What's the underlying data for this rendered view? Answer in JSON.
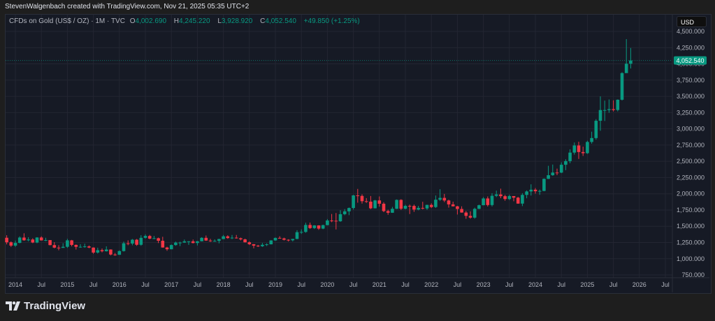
{
  "credit": "StevenWalgenbach created with TradingView.com, Nov 21, 2025 05:35 UTC+2",
  "legend": {
    "symbol": "CFDs on Gold (US$ / OZ) · 1M · TVC",
    "o_label": "O",
    "o_value": "4,002.690",
    "h_label": "H",
    "h_value": "4,245.220",
    "l_label": "L",
    "l_value": "3,928.920",
    "c_label": "C",
    "c_value": "4,052.540",
    "change": "+49.850 (+1.25%)"
  },
  "currency_button": "USD",
  "last_price_label": "4,052.540",
  "footer": {
    "brand": "TradingView"
  },
  "colors": {
    "up": "#089981",
    "down": "#f23645",
    "background": "#161a25",
    "grid": "#232632"
  },
  "chart_data": {
    "type": "candlestick",
    "interval": "1M",
    "start_month": "2013-11",
    "last_price": 4052.54,
    "ylim": [
      750,
      4500
    ],
    "y_ticks": [
      "4,500.000",
      "4,250.000",
      "4,000.000",
      "3,750.000",
      "3,500.000",
      "3,250.000",
      "3,000.000",
      "2,750.000",
      "2,500.000",
      "2,250.000",
      "2,000.000",
      "1,750.000",
      "1,500.000",
      "1,250.000",
      "1,000.000",
      "750.000"
    ],
    "x_ticks": [
      "2014",
      "Jul",
      "2015",
      "Jul",
      "2016",
      "Jul",
      "2017",
      "Jul",
      "2018",
      "Jul",
      "2019",
      "Jul",
      "2020",
      "Jul",
      "2021",
      "Jul",
      "2022",
      "Jul",
      "2023",
      "Jul",
      "2024",
      "Jul",
      "2025",
      "Jul",
      "2026",
      "Jul"
    ],
    "grid": true,
    "ohlc": [
      [
        1323,
        1362,
        1221,
        1253
      ],
      [
        1253,
        1267,
        1181,
        1202
      ],
      [
        1202,
        1280,
        1182,
        1244
      ],
      [
        1244,
        1345,
        1238,
        1326
      ],
      [
        1326,
        1392,
        1277,
        1284
      ],
      [
        1284,
        1331,
        1268,
        1296
      ],
      [
        1296,
        1315,
        1240,
        1250
      ],
      [
        1250,
        1332,
        1240,
        1327
      ],
      [
        1327,
        1345,
        1280,
        1282
      ],
      [
        1282,
        1323,
        1271,
        1287
      ],
      [
        1287,
        1288,
        1206,
        1210
      ],
      [
        1210,
        1255,
        1161,
        1171
      ],
      [
        1171,
        1208,
        1131,
        1167
      ],
      [
        1167,
        1239,
        1170,
        1184
      ],
      [
        1184,
        1307,
        1167,
        1283
      ],
      [
        1283,
        1290,
        1191,
        1213
      ],
      [
        1213,
        1220,
        1142,
        1183
      ],
      [
        1183,
        1224,
        1170,
        1184
      ],
      [
        1184,
        1232,
        1170,
        1190
      ],
      [
        1190,
        1205,
        1162,
        1172
      ],
      [
        1172,
        1175,
        1077,
        1095
      ],
      [
        1095,
        1170,
        1080,
        1132
      ],
      [
        1132,
        1157,
        1098,
        1115
      ],
      [
        1115,
        1191,
        1111,
        1142
      ],
      [
        1142,
        1145,
        1052,
        1065
      ],
      [
        1065,
        1088,
        1046,
        1061
      ],
      [
        1061,
        1129,
        1060,
        1118
      ],
      [
        1118,
        1263,
        1110,
        1238
      ],
      [
        1238,
        1283,
        1208,
        1234
      ],
      [
        1234,
        1304,
        1207,
        1293
      ],
      [
        1293,
        1304,
        1199,
        1215
      ],
      [
        1215,
        1362,
        1200,
        1322
      ],
      [
        1322,
        1375,
        1310,
        1351
      ],
      [
        1351,
        1367,
        1301,
        1309
      ],
      [
        1309,
        1352,
        1302,
        1316
      ],
      [
        1316,
        1326,
        1241,
        1277
      ],
      [
        1277,
        1338,
        1171,
        1173
      ],
      [
        1173,
        1184,
        1122,
        1146
      ],
      [
        1146,
        1220,
        1146,
        1211
      ],
      [
        1211,
        1264,
        1200,
        1249
      ],
      [
        1249,
        1262,
        1195,
        1249
      ],
      [
        1249,
        1296,
        1244,
        1268
      ],
      [
        1268,
        1272,
        1214,
        1268
      ],
      [
        1268,
        1296,
        1236,
        1242
      ],
      [
        1242,
        1273,
        1204,
        1269
      ],
      [
        1269,
        1331,
        1267,
        1322
      ],
      [
        1322,
        1358,
        1275,
        1280
      ],
      [
        1280,
        1306,
        1260,
        1271
      ],
      [
        1271,
        1299,
        1263,
        1275
      ],
      [
        1275,
        1307,
        1237,
        1303
      ],
      [
        1303,
        1366,
        1302,
        1345
      ],
      [
        1345,
        1361,
        1307,
        1318
      ],
      [
        1318,
        1366,
        1303,
        1325
      ],
      [
        1325,
        1366,
        1310,
        1315
      ],
      [
        1315,
        1326,
        1282,
        1298
      ],
      [
        1298,
        1309,
        1250,
        1253
      ],
      [
        1253,
        1266,
        1211,
        1224
      ],
      [
        1224,
        1226,
        1160,
        1201
      ],
      [
        1201,
        1214,
        1180,
        1192
      ],
      [
        1192,
        1243,
        1182,
        1215
      ],
      [
        1215,
        1237,
        1196,
        1222
      ],
      [
        1222,
        1285,
        1221,
        1282
      ],
      [
        1282,
        1326,
        1276,
        1321
      ],
      [
        1321,
        1347,
        1310,
        1313
      ],
      [
        1313,
        1324,
        1281,
        1292
      ],
      [
        1292,
        1300,
        1266,
        1284
      ],
      [
        1284,
        1306,
        1267,
        1305
      ],
      [
        1305,
        1439,
        1301,
        1409
      ],
      [
        1409,
        1453,
        1382,
        1413
      ],
      [
        1413,
        1555,
        1400,
        1520
      ],
      [
        1520,
        1557,
        1459,
        1472
      ],
      [
        1472,
        1517,
        1458,
        1513
      ],
      [
        1513,
        1516,
        1445,
        1464
      ],
      [
        1464,
        1525,
        1455,
        1517
      ],
      [
        1517,
        1611,
        1516,
        1589
      ],
      [
        1589,
        1689,
        1563,
        1585
      ],
      [
        1585,
        1704,
        1451,
        1577
      ],
      [
        1577,
        1747,
        1568,
        1686
      ],
      [
        1686,
        1765,
        1670,
        1730
      ],
      [
        1730,
        1789,
        1671,
        1781
      ],
      [
        1781,
        1984,
        1757,
        1975
      ],
      [
        1975,
        2075,
        1863,
        1967
      ],
      [
        1967,
        1992,
        1849,
        1886
      ],
      [
        1886,
        1933,
        1860,
        1879
      ],
      [
        1879,
        1966,
        1764,
        1776
      ],
      [
        1776,
        1906,
        1775,
        1898
      ],
      [
        1898,
        1959,
        1802,
        1847
      ],
      [
        1847,
        1871,
        1717,
        1734
      ],
      [
        1734,
        1755,
        1677,
        1708
      ],
      [
        1708,
        1798,
        1706,
        1769
      ],
      [
        1769,
        1913,
        1765,
        1906
      ],
      [
        1906,
        1916,
        1750,
        1770
      ],
      [
        1770,
        1832,
        1761,
        1814
      ],
      [
        1814,
        1834,
        1688,
        1813
      ],
      [
        1813,
        1834,
        1722,
        1757
      ],
      [
        1757,
        1814,
        1746,
        1783
      ],
      [
        1783,
        1877,
        1759,
        1774
      ],
      [
        1774,
        1831,
        1753,
        1829
      ],
      [
        1829,
        1853,
        1780,
        1796
      ],
      [
        1796,
        1974,
        1782,
        1909
      ],
      [
        1909,
        2070,
        1890,
        1937
      ],
      [
        1937,
        1998,
        1872,
        1897
      ],
      [
        1897,
        1910,
        1787,
        1837
      ],
      [
        1837,
        1879,
        1805,
        1807
      ],
      [
        1807,
        1814,
        1681,
        1766
      ],
      [
        1766,
        1807,
        1709,
        1711
      ],
      [
        1711,
        1735,
        1615,
        1660
      ],
      [
        1660,
        1730,
        1617,
        1633
      ],
      [
        1633,
        1786,
        1616,
        1768
      ],
      [
        1768,
        1833,
        1765,
        1824
      ],
      [
        1824,
        1949,
        1823,
        1928
      ],
      [
        1928,
        1959,
        1804,
        1827
      ],
      [
        1827,
        2009,
        1805,
        1969
      ],
      [
        1969,
        2048,
        1950,
        1990
      ],
      [
        1990,
        2079,
        1932,
        1963
      ],
      [
        1963,
        1984,
        1893,
        1919
      ],
      [
        1919,
        1987,
        1903,
        1965
      ],
      [
        1965,
        1949,
        1885,
        1940
      ],
      [
        1940,
        1953,
        1846,
        1849
      ],
      [
        1849,
        2009,
        1810,
        1983
      ],
      [
        1983,
        2052,
        1931,
        2036
      ],
      [
        2036,
        2146,
        1973,
        2063
      ],
      [
        2063,
        2088,
        2002,
        2039
      ],
      [
        2039,
        2065,
        1984,
        2044
      ],
      [
        2044,
        2236,
        2039,
        2230
      ],
      [
        2230,
        2431,
        2228,
        2286
      ],
      [
        2286,
        2450,
        2277,
        2327
      ],
      [
        2327,
        2388,
        2287,
        2326
      ],
      [
        2326,
        2484,
        2318,
        2447
      ],
      [
        2447,
        2531,
        2364,
        2503
      ],
      [
        2503,
        2685,
        2471,
        2634
      ],
      [
        2634,
        2790,
        2603,
        2744
      ],
      [
        2744,
        2801,
        2537,
        2643
      ],
      [
        2643,
        2726,
        2583,
        2625
      ],
      [
        2625,
        2817,
        2614,
        2798
      ],
      [
        2798,
        2956,
        2772,
        2858
      ],
      [
        2858,
        3149,
        2833,
        3124
      ],
      [
        3124,
        3500,
        2970,
        3289
      ],
      [
        3289,
        3435,
        3121,
        3289
      ],
      [
        3289,
        3452,
        3247,
        3303
      ],
      [
        3303,
        3439,
        3268,
        3290
      ],
      [
        3290,
        3453,
        3268,
        3448
      ],
      [
        3448,
        3872,
        3436,
        3858
      ],
      [
        3858,
        4381,
        3887,
        4002.69
      ],
      [
        4002.69,
        4245.22,
        3928.92,
        4052.54
      ]
    ]
  }
}
